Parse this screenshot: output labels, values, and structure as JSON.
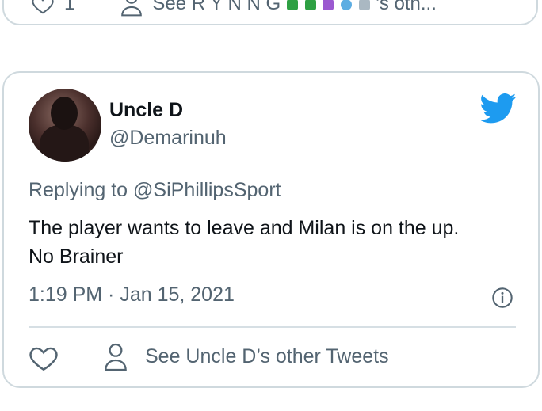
{
  "previous_tweet": {
    "like_count": "1",
    "see_other_label": "See R Y N N G",
    "other_suffix": "'s oth..."
  },
  "tweet": {
    "display_name": "Uncle D",
    "handle": "@Demarinuh",
    "replying_prefix": "Replying to ",
    "replying_to": "@SiPhillipsSport",
    "text_line1": "The player wants to leave and Milan is on the up.",
    "text_line2": "No Brainer",
    "timestamp": "1:19 PM · Jan 15, 2021",
    "see_other_tweets": "See Uncle D’s other Tweets"
  },
  "colors": {
    "twitter_blue": "#1d9bf0",
    "secondary_text": "#536471",
    "border": "#cfd9de"
  },
  "icons": [
    "heart-icon",
    "person-icon",
    "twitter-logo-icon",
    "info-icon"
  ]
}
